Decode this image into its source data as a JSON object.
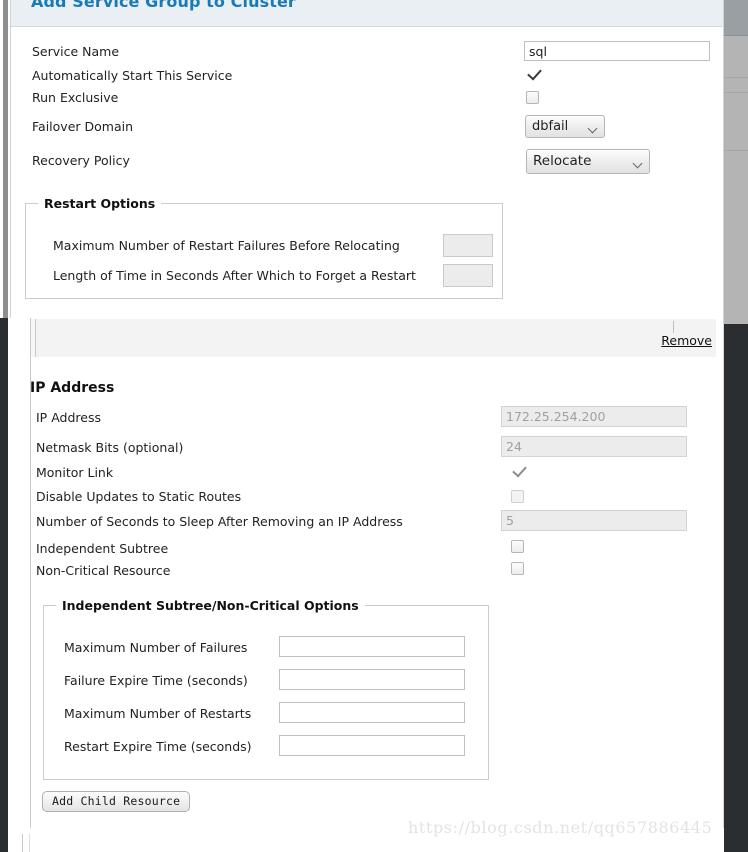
{
  "window": {
    "title": "Add Service Group to Cluster"
  },
  "service_form": {
    "fields": [
      {
        "label": "Service Name",
        "type": "text",
        "value": "sql"
      },
      {
        "label": "Automatically Start This Service",
        "type": "checkbox",
        "checked": true
      },
      {
        "label": "Run Exclusive",
        "type": "checkbox",
        "checked": false
      },
      {
        "label": "Failover Domain",
        "type": "select",
        "value": "dbfail"
      },
      {
        "label": "Recovery Policy",
        "type": "select",
        "value": "Relocate"
      }
    ],
    "restart_options": {
      "legend": "Restart Options",
      "rows": [
        {
          "label": "Maximum Number of Restart Failures Before Relocating",
          "value": ""
        },
        {
          "label": "Length of Time in Seconds After Which to Forget a Restart",
          "value": ""
        }
      ]
    }
  },
  "resource_panel": {
    "remove_label": "Remove",
    "section_title": "IP Address",
    "fields": [
      {
        "label": "IP Address",
        "type": "text",
        "value": "172.25.254.200",
        "disabled": true
      },
      {
        "label": "Netmask Bits (optional)",
        "type": "text",
        "value": "24",
        "disabled": true
      },
      {
        "label": "Monitor Link",
        "type": "checkbox",
        "checked": true,
        "disabled": true
      },
      {
        "label": "Disable Updates to Static Routes",
        "type": "checkbox",
        "checked": false,
        "disabled": true
      },
      {
        "label": "Number of Seconds to Sleep After Removing an IP Address",
        "type": "text",
        "value": "5",
        "disabled": true
      },
      {
        "label": "Independent Subtree",
        "type": "checkbox",
        "checked": false,
        "disabled": false
      },
      {
        "label": "Non-Critical Resource",
        "type": "checkbox",
        "checked": false,
        "disabled": false
      }
    ],
    "subtree_options": {
      "legend": "Independent Subtree/Non-Critical Options",
      "rows": [
        {
          "label": "Maximum Number of Failures",
          "value": ""
        },
        {
          "label": "Failure Expire Time (seconds)",
          "value": ""
        },
        {
          "label": "Maximum Number of Restarts",
          "value": ""
        },
        {
          "label": "Restart Expire Time (seconds)",
          "value": ""
        }
      ]
    },
    "add_child_button": "Add Child Resource"
  },
  "watermark": {
    "text": "https://blog.csdn.net/qq657886445"
  },
  "colors": {
    "header_bg": "#e9eff2",
    "title_blue": "#1a7ab5",
    "panel_border": "#cfd4d7",
    "disabled_field_bg": "#ececec",
    "resource_header_bg": "#f3f3f3"
  }
}
